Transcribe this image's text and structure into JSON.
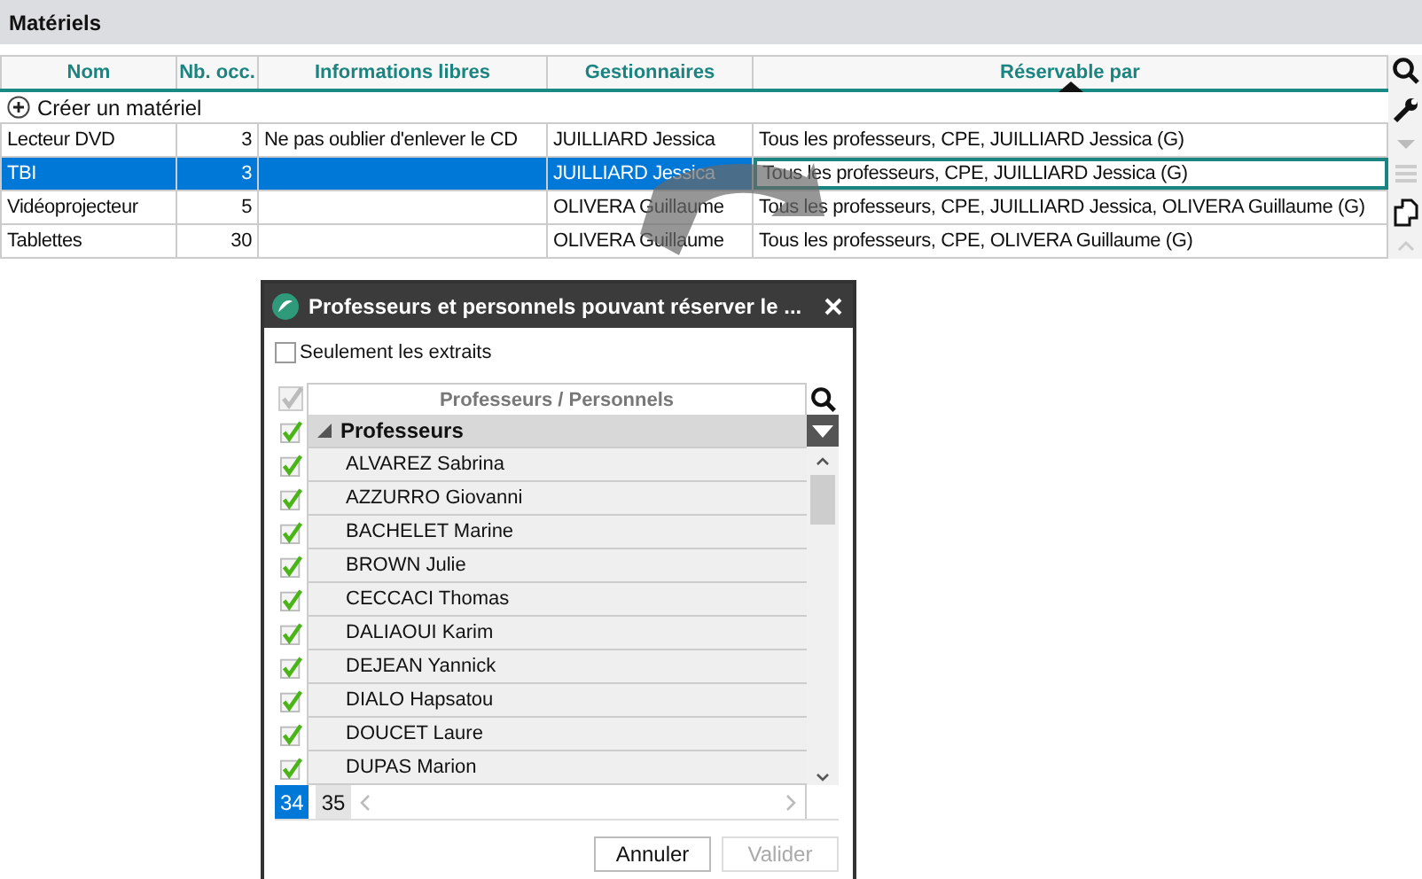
{
  "section_title": "Matériels",
  "table": {
    "columns": [
      {
        "label": "Nom",
        "sorted": false
      },
      {
        "label": "Nb. occ.",
        "sorted": false
      },
      {
        "label": "Informations libres",
        "sorted": false
      },
      {
        "label": "Gestionnaires",
        "sorted": false
      },
      {
        "label": "Réservable par",
        "sorted": true
      }
    ],
    "create_label": "Créer un matériel",
    "rows": [
      {
        "name": "Lecteur DVD",
        "count": "3",
        "info": "Ne pas oublier d'enlever le CD",
        "managers": "JUILLIARD Jessica",
        "reservable_by": "Tous les professeurs, CPE, JUILLIARD Jessica (G)",
        "selected": false
      },
      {
        "name": "TBI",
        "count": "3",
        "info": "",
        "managers": "JUILLIARD Jessica",
        "reservable_by": "Tous les professeurs, CPE, JUILLIARD Jessica (G)",
        "selected": true
      },
      {
        "name": "Vidéoprojecteur",
        "count": "5",
        "info": "",
        "managers": "OLIVERA Guillaume",
        "reservable_by": "Tous les professeurs, CPE, JUILLIARD Jessica, OLIVERA Guillaume (G)",
        "selected": false
      },
      {
        "name": "Tablettes",
        "count": "30",
        "info": "",
        "managers": "OLIVERA Guillaume",
        "reservable_by": "Tous les professeurs, CPE, OLIVERA Guillaume (G)",
        "selected": false
      }
    ]
  },
  "dialog": {
    "title": "Professeurs et personnels pouvant réserver le ...",
    "extracts_only": {
      "label": "Seulement les extraits",
      "checked": false
    },
    "select_all": {
      "checked": true
    },
    "column": "Professeurs / Personnels",
    "group": {
      "label": "Professeurs",
      "checked": true,
      "expanded": true,
      "children": [
        {
          "name": "ALVAREZ Sabrina",
          "checked": true
        },
        {
          "name": "AZZURRO Giovanni",
          "checked": true
        },
        {
          "name": "BACHELET Marine",
          "checked": true
        },
        {
          "name": "BROWN Julie",
          "checked": true
        },
        {
          "name": "CECCACI Thomas",
          "checked": true
        },
        {
          "name": "DALIAOUI Karim",
          "checked": true
        },
        {
          "name": "DEJEAN Yannick",
          "checked": true
        },
        {
          "name": "DIALO Hapsatou",
          "checked": true
        },
        {
          "name": "DOUCET Laure",
          "checked": true
        },
        {
          "name": "DUPAS Marion",
          "checked": true
        }
      ]
    },
    "pages": [
      {
        "label": "34",
        "selected": true
      },
      {
        "label": "35",
        "selected": false
      }
    ],
    "buttons": [
      {
        "label": "Annuler",
        "disabled": false
      },
      {
        "label": "Valider",
        "disabled": true
      }
    ]
  }
}
